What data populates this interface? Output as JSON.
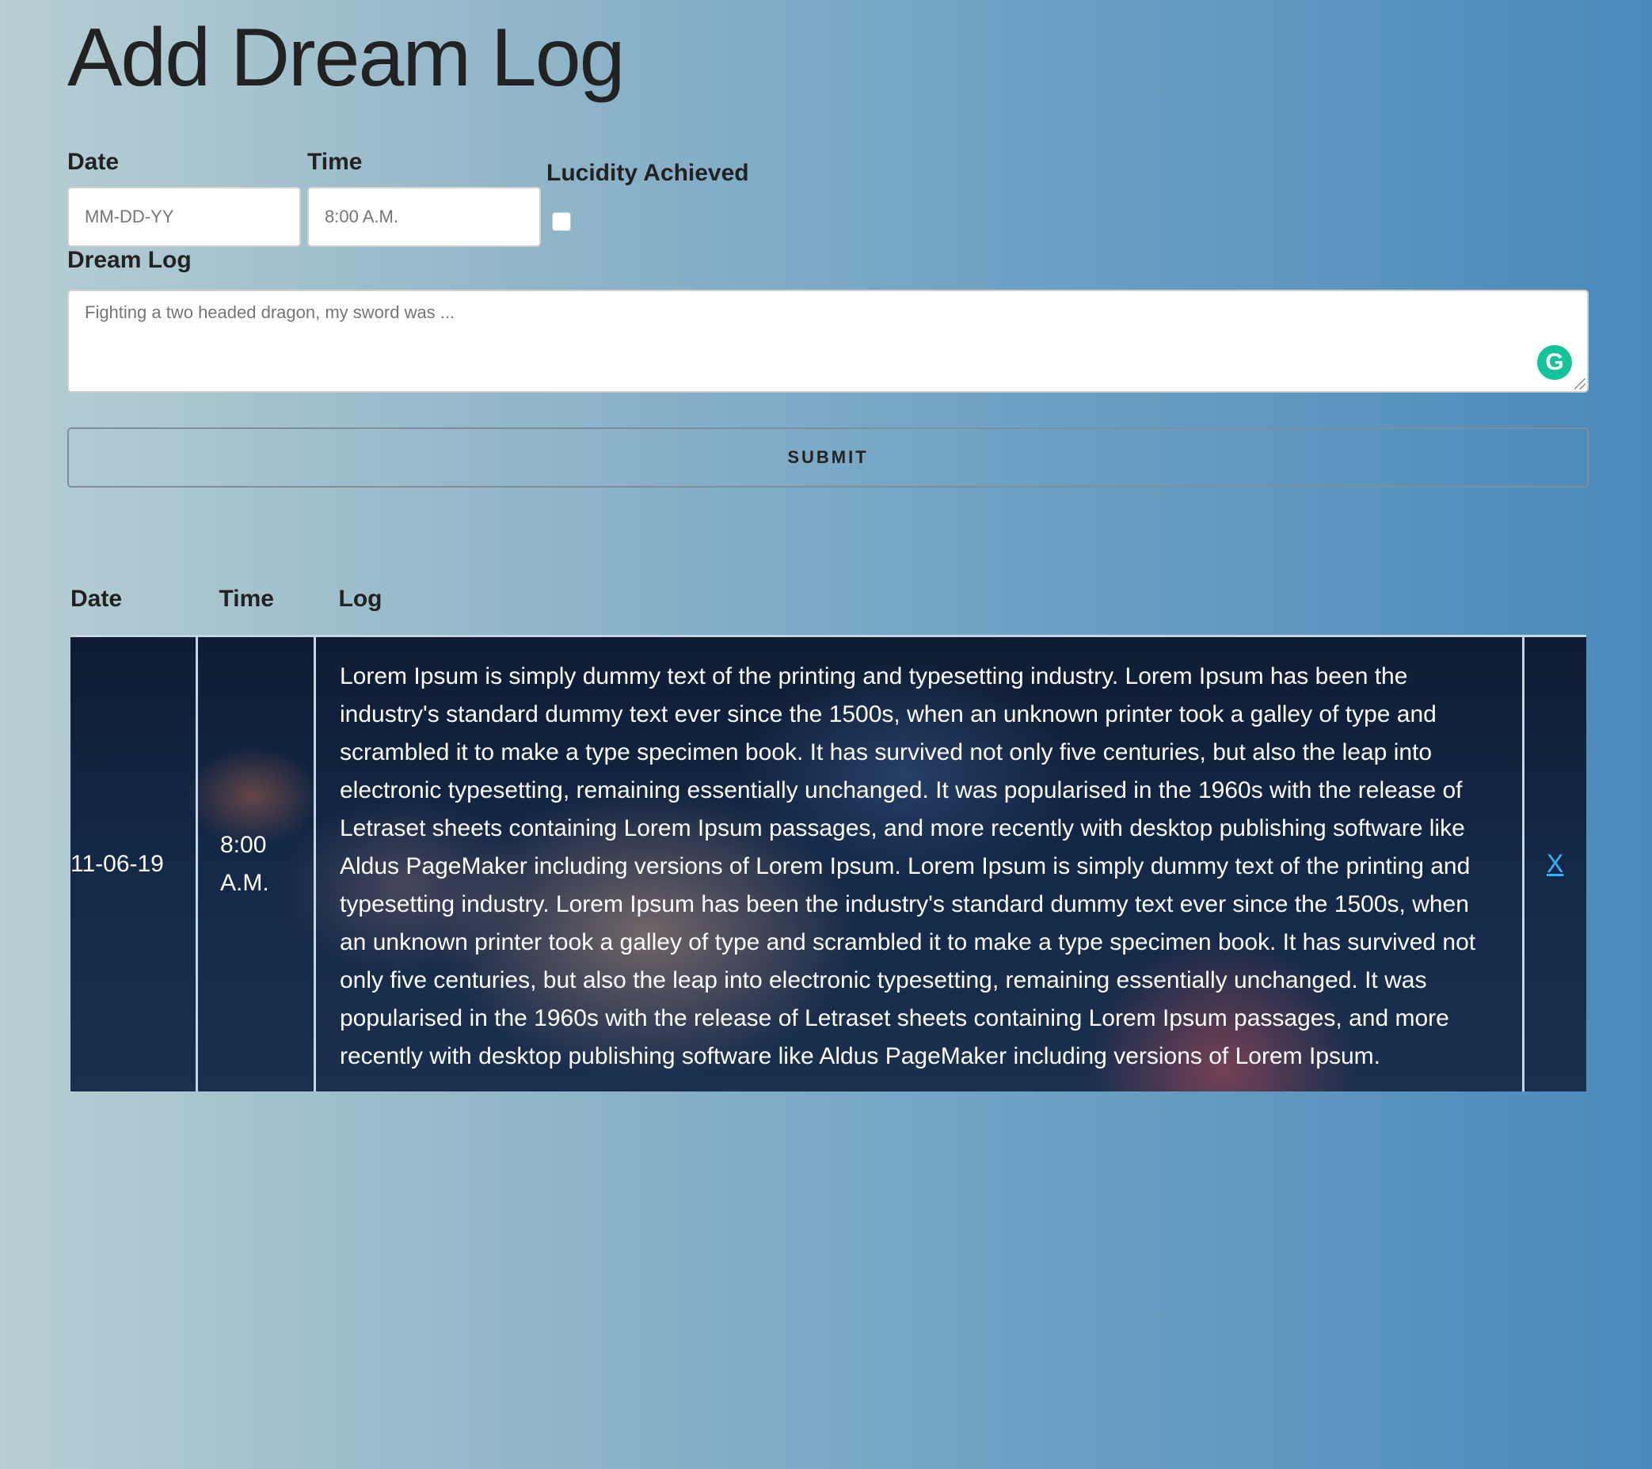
{
  "page": {
    "title": "Add Dream Log"
  },
  "form": {
    "date_label": "Date",
    "date_placeholder": "MM-DD-YY",
    "time_label": "Time",
    "time_placeholder": "8:00 A.M.",
    "lucidity_label": "Lucidity Achieved",
    "lucidity_checked": false,
    "dream_log_label": "Dream Log",
    "dream_log_placeholder": "Fighting a two headed dragon, my sword was ...",
    "grammarly_icon": "G",
    "submit_label": "SUBMIT"
  },
  "table": {
    "headers": [
      "Date",
      "Time",
      "Log"
    ],
    "rows": [
      {
        "date": "11-06-19",
        "time": "8:00 A.M.",
        "log": "Lorem Ipsum is simply dummy text of the printing and typesetting industry. Lorem Ipsum has been the industry's standard dummy text ever since the 1500s, when an unknown printer took a galley of type and scrambled it to make a type specimen book. It has survived not only five centuries, but also the leap into electronic typesetting, remaining essentially unchanged. It was popularised in the 1960s with the release of Letraset sheets containing Lorem Ipsum passages, and more recently with desktop publishing software like Aldus PageMaker including versions of Lorem Ipsum. Lorem Ipsum is simply dummy text of the printing and typesetting industry. Lorem Ipsum has been the industry's standard dummy text ever since the 1500s, when an unknown printer took a galley of type and scrambled it to make a type specimen book. It has survived not only five centuries, but also the leap into electronic typesetting, remaining essentially unchanged. It was popularised in the 1960s with the release of Letraset sheets containing Lorem Ipsum passages, and more recently with desktop publishing software like Aldus PageMaker including versions of Lorem Ipsum.",
        "delete_label": "X"
      }
    ]
  },
  "colors": {
    "link": "#33b4ff",
    "grammarly": "#15c39a"
  }
}
